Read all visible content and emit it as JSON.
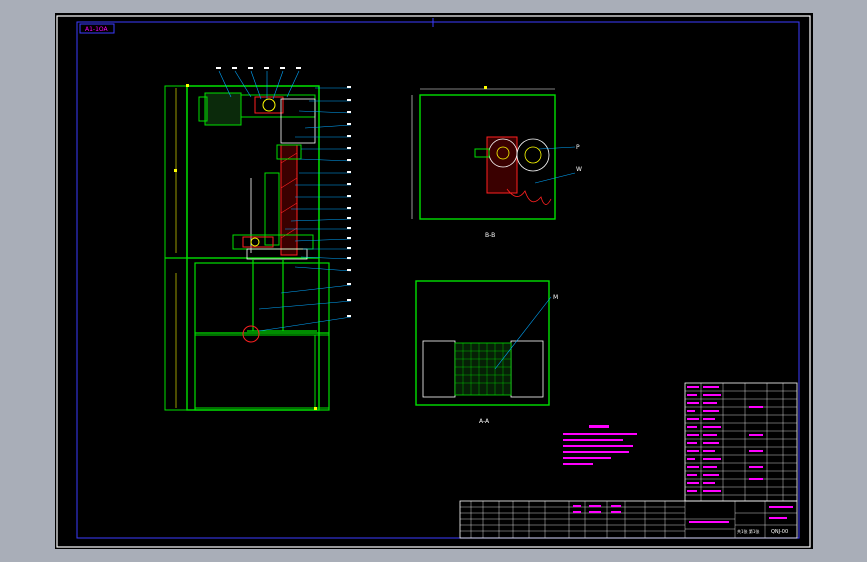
{
  "drawing": {
    "sheet_tag": "A1-1OA",
    "view_titles": {
      "side_view": "B-B",
      "front_view": "A-A"
    },
    "note_lines": {
      "motor": "M",
      "tag_p": "P",
      "tag_w": "W"
    }
  },
  "title_block": {
    "drawing_number": "QNJ-00",
    "sheet_text": "共1张 第1张"
  },
  "colors": {
    "frame": "#3b3bff",
    "outline": "#00e000",
    "leader": "#00a8ff",
    "section": "#ff2020",
    "text_magenta": "#ff00ff",
    "text_white": "#ffffff",
    "dim_yellow": "#ffff00",
    "canvas_bg": "#000000",
    "page_bg": "#a9aeb8"
  }
}
